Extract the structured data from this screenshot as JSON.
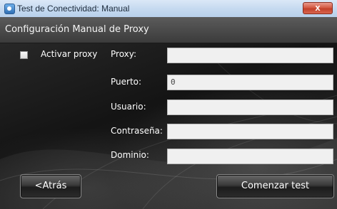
{
  "window": {
    "title": "Test de Conectividad: Manual",
    "close_label": "x"
  },
  "header": {
    "title": "Configuración Manual de Proxy"
  },
  "proxy_toggle": {
    "label": "Activar proxy",
    "checked": false
  },
  "fields": {
    "proxy": {
      "label": "Proxy:",
      "value": ""
    },
    "port": {
      "label": "Puerto:",
      "value": "0"
    },
    "user": {
      "label": "Usuario:",
      "value": ""
    },
    "password": {
      "label": "Contraseña:",
      "value": ""
    },
    "domain": {
      "label": "Dominio:",
      "value": ""
    }
  },
  "buttons": {
    "back": "<Atrás",
    "start": "Comenzar test"
  },
  "colors": {
    "header_bar": "#4a4a4a",
    "body_background": "#1c1c1c",
    "close_button": "#d45b45",
    "titlebar": "#c6daf0"
  }
}
